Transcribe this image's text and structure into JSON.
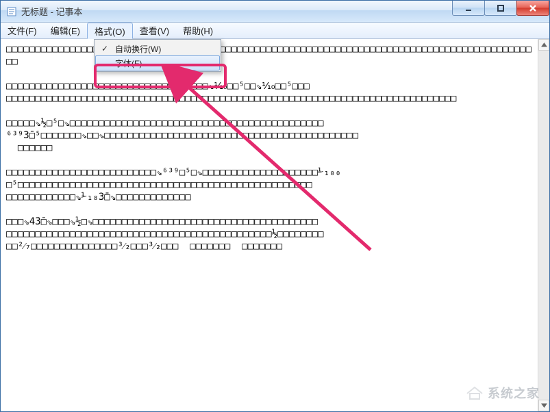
{
  "window": {
    "title": "无标题 - 记事本"
  },
  "menu": {
    "file": "文件(F)",
    "edit": "编辑(E)",
    "format": "格式(O)",
    "view": "查看(V)",
    "help": "帮助(H)"
  },
  "format_dropdown": {
    "wordwrap": "自动换行(W)",
    "font": "字体(F)..."
  },
  "annotation": {
    "target": "font-menu-item"
  },
  "watermark": {
    "text": "系统之家"
  },
  "content": {
    "body": "□□□□□□□□□□□□□□□□□□□□□□□□□□□□□□□□□□□□□□□□□□□□□□□□□□□□□□□□□□□□□□□□□□□□□□□□□□□□□□□□□□□□□□□□□□□□□\n\n□□□□□□□□□□□□□□□□□□□□□□□□□□□□□□□□□□□⇘⅒□□⁵□□⇘⅒□□⁵□□□\n□□□□□□□□□□□□□□□□□□□□□□□□□□□□□□□□□□□□□□□□□□□□□□□□□□□□□□□□□□□□□□□□□□□□□□□□□□□□□□\n\n□□□□□⇘½□⁵□⇘□□□□□□□□□□□□□□□□□□□□□□□□□□□□□□□□□□□□□□□□□□□□\n⁶³⁹3̄□⁵□□□□□□□⇘□□⇘□□□□□□□□□□□□□□□□□□□□□□□□□□□□□□□□□□□□□□□□□□□□\n  □□□□□□\n\n□□□□□□□□□□□□□□□□□□□□□□□□□□⇘⁶³⁹□⁵□⇘□□□□□□□□□□□□□□□□□□□□⅟₁₀₀\n□⁵□□□□□□□□□□□□□□□□□□□□□□□□□□□□□□□□□□□□□□□□□□□□□□□□□□□\n□□□□□□□□□□□□⇘⅟₁₈3̄□⇘□□□□□□□□□□□□□\n\n□□□⇘4̄3̄□⇘□□□⇘½□⇘□□□□□□□□□□□□□□□□□□□□□□□□□□□□□□□□□□□□□□□\n□□□□□□□□□□□□□□□□□□□□□□□□□□□□□□□□□□□□□□□□□□□□□□½□□□□□□□□\n□□²⁄₇□□□□□□□□□□□□□□□³⁄₂□□□³⁄₂□□□  □□□□□□□  □□□□□□□"
  }
}
